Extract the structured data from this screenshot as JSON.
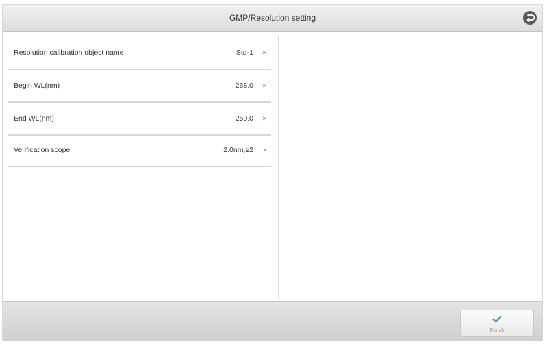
{
  "header": {
    "title": "GMP/Resolution setting",
    "back_icon": "back-icon"
  },
  "settings": [
    {
      "label": "Resolution calibration object name",
      "value": "Std-1",
      "chevron": ">"
    },
    {
      "label": "Begin WL(nm)",
      "value": "268.0",
      "chevron": ">"
    },
    {
      "label": "End WL(nm)",
      "value": "250.0",
      "chevron": ">"
    },
    {
      "label": "Verification scope",
      "value": "2.0nm,≥2",
      "chevron": ">"
    }
  ],
  "footer": {
    "finish_label": "Finish",
    "finish_icon": "checkmark-icon"
  },
  "colors": {
    "accent": "#3a8fd8",
    "back_button": "#5a5a5a"
  }
}
